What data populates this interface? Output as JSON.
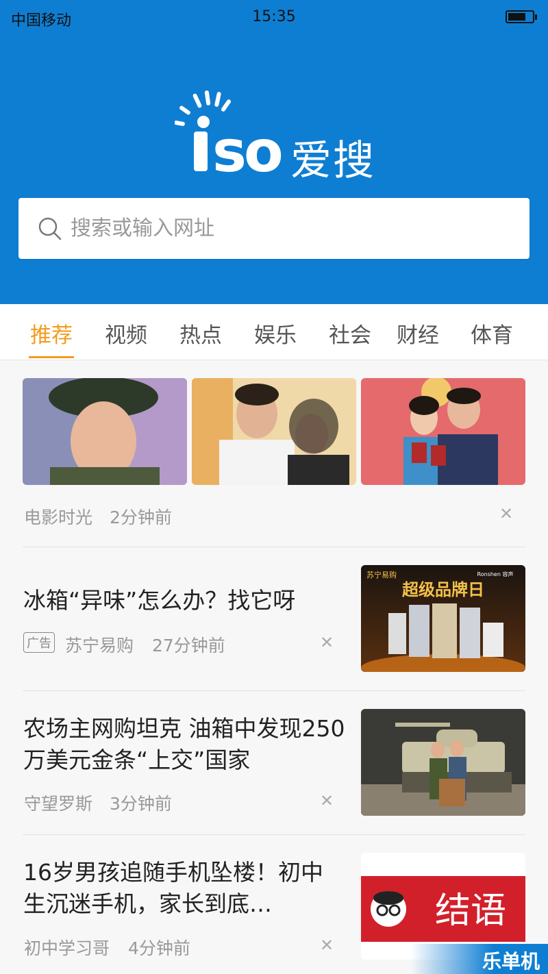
{
  "status_bar": {
    "carrier": "中国移动",
    "time": "15:35",
    "battery_level": 0.7
  },
  "brand": {
    "logo_latin": "iso",
    "logo_text": "爱搜",
    "color": "#0e7ed3"
  },
  "search": {
    "placeholder": "搜索或输入网址"
  },
  "tabs": [
    "推荐",
    "视频",
    "热点",
    "娱乐",
    "社会",
    "财经",
    "体育"
  ],
  "active_tab": "推荐",
  "accent_color": "#f39c1f",
  "feed": [
    {
      "type": "gallery",
      "source": "电影时光",
      "time": "2分钟前"
    },
    {
      "type": "ad",
      "title": "冰箱“异味”怎么办？找它呀",
      "badge": "广告",
      "source": "苏宁易购",
      "time": "27分钟前",
      "image_text": {
        "brand": "苏宁易购",
        "slogan": "超级品牌日",
        "corner": "Ronshen 容声"
      }
    },
    {
      "type": "article",
      "title": "农场主网购坦克 油箱中发现250万美元金条“上交”国家",
      "source": "守望罗斯",
      "time": "3分钟前"
    },
    {
      "type": "article",
      "title": "16岁男孩追随手机坠楼！初中生沉迷手机，家长到底…",
      "source": "初中学习哥",
      "time": "4分钟前",
      "image_text": {
        "caption": "结语"
      }
    }
  ],
  "watermark": "乐单机"
}
